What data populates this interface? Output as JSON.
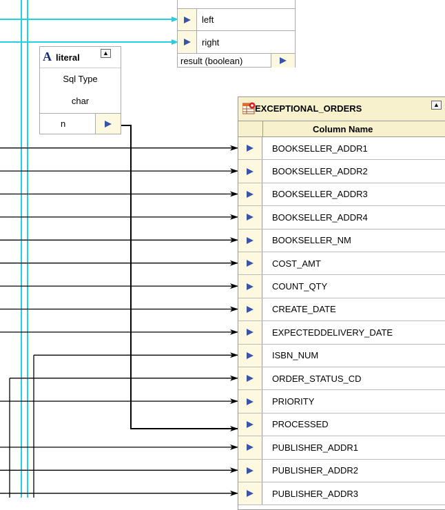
{
  "colors": {
    "cyan_wire": "#22d0e0",
    "black_wire": "#000000",
    "pink_wire": "#ee7799",
    "port_triangle": "#3a54a8",
    "port_bg": "#fdf9e0",
    "header_bg": "#f7f2cd",
    "border": "#8a8a8a"
  },
  "operator": {
    "inputs": [
      "left",
      "right"
    ],
    "output": "result (boolean)"
  },
  "literal": {
    "icon_letter": "A",
    "title": "literal",
    "collapse_glyph": "▲",
    "rows": [
      "Sql Type",
      "char"
    ],
    "output": "n"
  },
  "table": {
    "title": "EXCEPTIONAL_ORDERS",
    "collapse_glyph": "▲",
    "column_header": "Column Name",
    "columns": [
      "BOOKSELLER_ADDR1",
      "BOOKSELLER_ADDR2",
      "BOOKSELLER_ADDR3",
      "BOOKSELLER_ADDR4",
      "BOOKSELLER_NM",
      "COST_AMT",
      "COUNT_QTY",
      "CREATE_DATE",
      "EXPECTEDDELIVERY_DATE",
      "ISBN_NUM",
      "ORDER_STATUS_CD",
      "PRIORITY",
      "PROCESSED",
      "PUBLISHER_ADDR1",
      "PUBLISHER_ADDR2",
      "PUBLISHER_ADDR3"
    ]
  },
  "icons": {
    "port": "port-arrow-icon",
    "table": "table-icon",
    "literal": "literal-icon",
    "collapse": "collapse-icon"
  }
}
